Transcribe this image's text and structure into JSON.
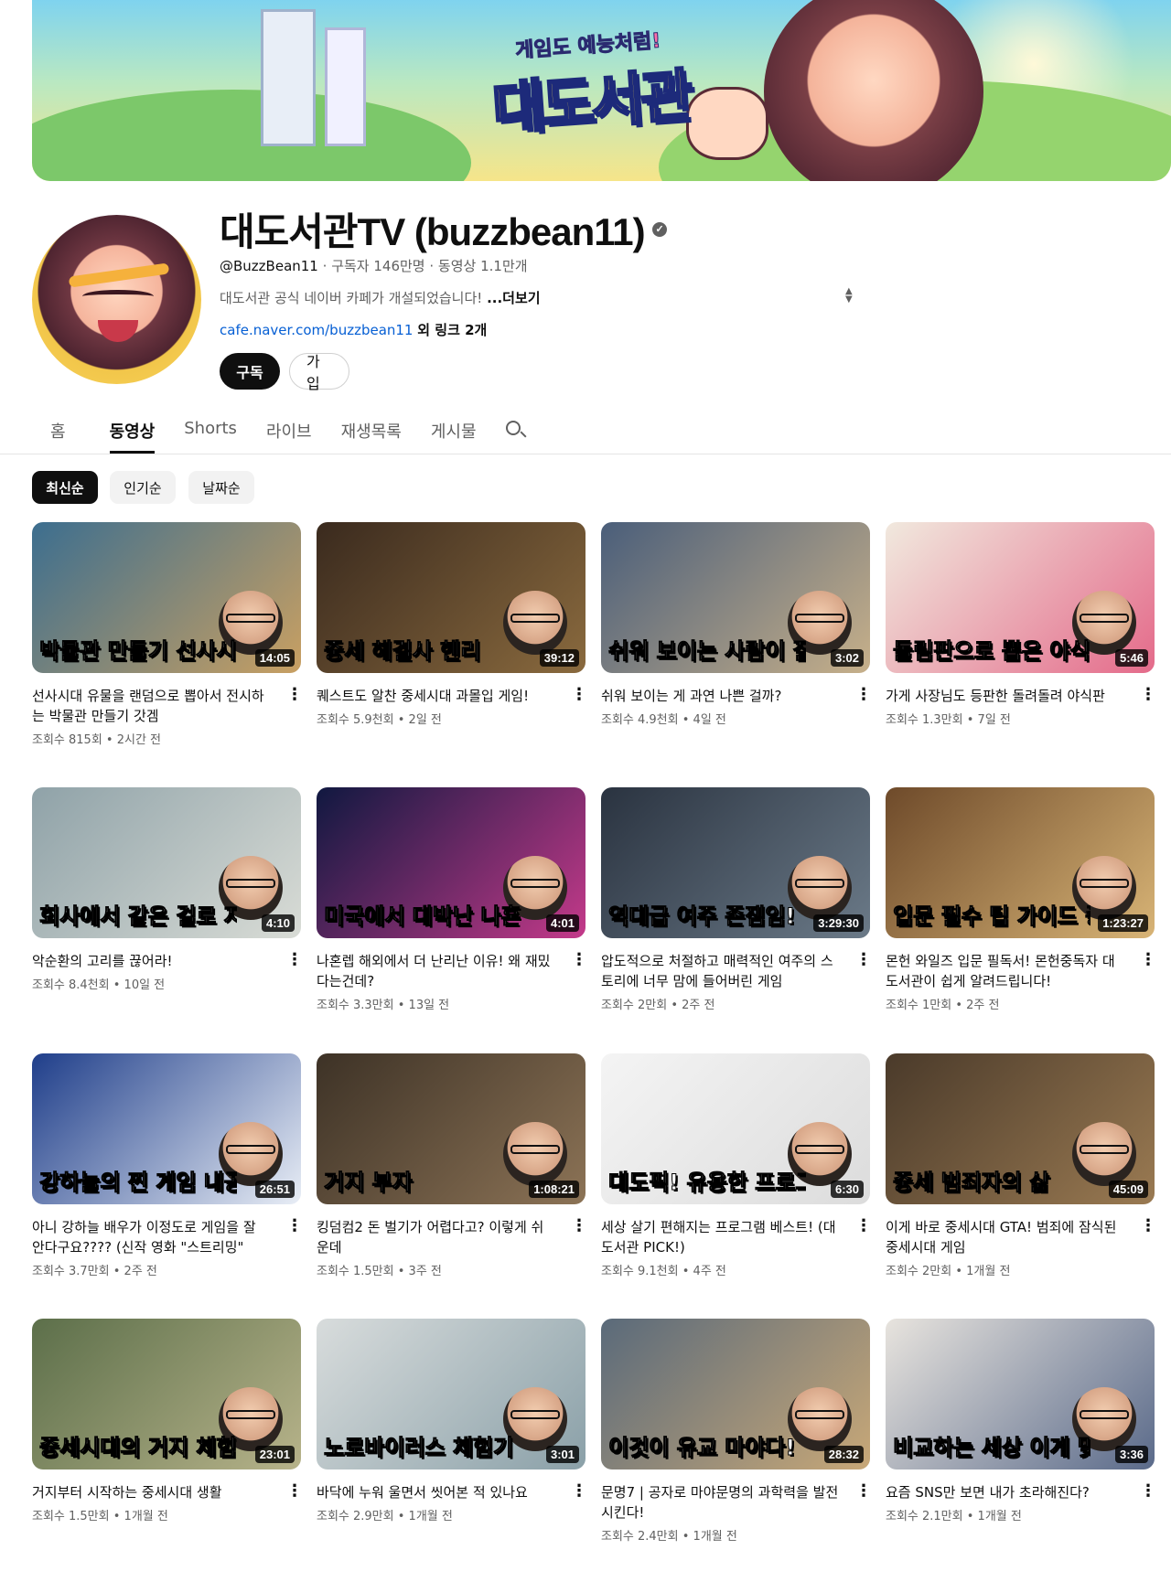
{
  "banner": {
    "tagline": "게임도 예능처럼!",
    "logo_text": "대도서관"
  },
  "channel": {
    "title": "대도서관TV (buzzbean11)",
    "handle": "@BuzzBean11",
    "subscribers": "구독자 146만명",
    "video_count": "동영상 1.1만개",
    "description": "대도서관 공식 네이버 카페가 개설되었습니다!",
    "more_label": "...더보기",
    "link_url": "cafe.naver.com/buzzbean11",
    "link_extra": "외 링크 2개",
    "subscribe_label": "구독",
    "join_label": "가입"
  },
  "tabs": [
    {
      "label": "홈",
      "active": false
    },
    {
      "label": "동영상",
      "active": true
    },
    {
      "label": "Shorts",
      "active": false
    },
    {
      "label": "라이브",
      "active": false
    },
    {
      "label": "재생목록",
      "active": false
    },
    {
      "label": "게시물",
      "active": false
    }
  ],
  "chips": [
    {
      "label": "최신순",
      "active": true
    },
    {
      "label": "인기순",
      "active": false
    },
    {
      "label": "날짜순",
      "active": false
    }
  ],
  "videos": [
    {
      "title": "선사시대 유물을 랜덤으로 뽑아서 전시하는 박물관 만들기 갓겜",
      "views": "조회수 815회",
      "age": "2시간 전",
      "duration": "14:05",
      "thumb_text": "박물관 만들기 선사시대편",
      "bg1": "#3c6e8f",
      "bg2": "#c9a062"
    },
    {
      "title": "퀘스트도 알찬 중세시대 과몰입 게임!",
      "views": "조회수 5.9천회",
      "age": "2일 전",
      "duration": "39:12",
      "thumb_text": "중세 해결사 헨리",
      "bg1": "#3a2a1e",
      "bg2": "#8a6a3e"
    },
    {
      "title": "쉬워 보이는 게 과연 나쁜 걸까?",
      "views": "조회수 4.9천회",
      "age": "4일 전",
      "duration": "3:02",
      "thumb_text": "쉬워 보이는 사람이 잘 하더라",
      "bg1": "#4a5e7a",
      "bg2": "#c7b08a"
    },
    {
      "title": "가게 사장님도 등판한 돌려돌려 야식판",
      "views": "조회수 1.3만회",
      "age": "7일 전",
      "duration": "5:46",
      "thumb_text": "돌림판으로 뽑은 야식 상태가??",
      "bg1": "#f1e9de",
      "bg2": "#e46a8a"
    },
    {
      "title": "악순환의 고리를 끊어라!",
      "views": "조회수 8.4천회",
      "age": "10일 전",
      "duration": "4:10",
      "thumb_text": "회사에서 같은 걸로 자꾸 혼나요",
      "bg1": "#8fa2a8",
      "bg2": "#d9dcd6"
    },
    {
      "title": "나혼렙 해외에서 더 난리난 이유! 왜 재밌다는건데?",
      "views": "조회수 3.3만회",
      "age": "13일 전",
      "duration": "4:01",
      "thumb_text": "미국에서 대박난 나혼렙애니",
      "bg1": "#101840",
      "bg2": "#c43a8a"
    },
    {
      "title": "압도적으로 처절하고 매력적인 여주의 스토리에 너무 맘에 들어버린 게임",
      "views": "조회수 2만회",
      "age": "2주 전",
      "duration": "3:29:30",
      "thumb_text": "역대급 여주 존잼임!",
      "bg1": "#2a3340",
      "bg2": "#6b7a88"
    },
    {
      "title": "몬헌 와일즈 입문 필독서! 몬헌중독자 대도서관이 쉽게 알려드립니다!",
      "views": "조회수 1만회",
      "age": "2주 전",
      "duration": "1:23:27",
      "thumb_text": "입문 필수 팁 가이드 종결자",
      "bg1": "#6e4a2a",
      "bg2": "#d8b476"
    },
    {
      "title": "아니 강하늘 배우가 이정도로 게임을 잘 안다구요???? (신작 영화 \"스트리밍\" 인...",
      "views": "조회수 3.7만회",
      "age": "2주 전",
      "duration": "26:51",
      "thumb_text": "강하늘의 찐 게임 내공",
      "bg1": "#1f3e8a",
      "bg2": "#e9eef6"
    },
    {
      "title": "킹덤컴2 돈 벌기가 어렵다고? 이렇게 쉬운데",
      "views": "조회수 1.5만회",
      "age": "3주 전",
      "duration": "1:08:21",
      "thumb_text": "거지  부자",
      "bg1": "#3d3226",
      "bg2": "#8c7356"
    },
    {
      "title": "세상 살기 편해지는 프로그램 베스트! (대도서관 PICK!)",
      "views": "조회수 9.1천회",
      "age": "4주 전",
      "duration": "6:30",
      "thumb_text": "대도픽! 유용한 프로그램 베스트",
      "bg1": "#f4f4f4",
      "bg2": "#dcdcdc"
    },
    {
      "title": "이게 바로 중세시대 GTA! 범죄에 잠식된 중세시대 게임",
      "views": "조회수 2만회",
      "age": "1개월 전",
      "duration": "45:09",
      "thumb_text": "중세 범죄자의 삶",
      "bg1": "#4a3a2a",
      "bg2": "#9a7a52"
    },
    {
      "title": "거지부터 시작하는 중세시대 생활",
      "views": "조회수 1.5만회",
      "age": "1개월 전",
      "duration": "23:01",
      "thumb_text": "중세시대의 거지 체험하기",
      "bg1": "#5c6f4a",
      "bg2": "#b7b38a"
    },
    {
      "title": "바닥에 누워 울면서 씻어본 적 있나요",
      "views": "조회수 2.9만회",
      "age": "1개월 전",
      "duration": "3:01",
      "thumb_text": "노로바이러스 체험기",
      "bg1": "#d8dcdc",
      "bg2": "#8aa0a8"
    },
    {
      "title": "문명7 | 공자로 마야문명의 과학력을 발전시킨다!",
      "views": "조회수 2.4만회",
      "age": "1개월 전",
      "duration": "28:32",
      "thumb_text": "이것이 유교 마야다!",
      "bg1": "#5a6a7a",
      "bg2": "#c8a878"
    },
    {
      "title": "요즘 SNS만 보면 내가 초라해진다?",
      "views": "조회수 2.1만회",
      "age": "1개월 전",
      "duration": "3:36",
      "thumb_text": "비교하는 세상 이게 맞나요?",
      "bg1": "#e8e4de",
      "bg2": "#5a6a8a"
    }
  ]
}
